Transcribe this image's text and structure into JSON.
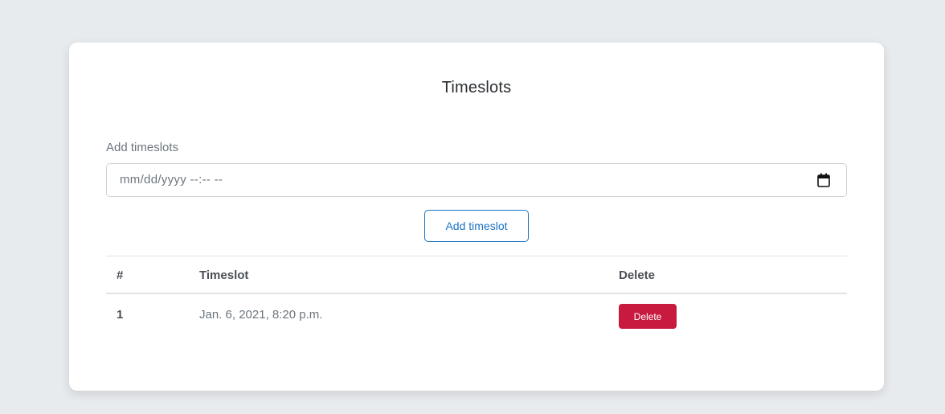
{
  "page": {
    "title": "Timeslots"
  },
  "form": {
    "label": "Add timeslots",
    "input_value": "mm/dd/yyyy --:-- --",
    "calendar_icon": "calendar-icon",
    "add_button_label": "Add timeslot"
  },
  "table": {
    "headers": [
      "#",
      "Timeslot",
      "Delete"
    ],
    "rows": [
      {
        "num": "1",
        "timeslot": "Jan. 6, 2021, 8:20 p.m.",
        "delete_label": "Delete"
      }
    ]
  },
  "colors": {
    "background": "#e8ebee",
    "accent_blue": "#1a73c4",
    "delete_red": "#c8193f"
  }
}
